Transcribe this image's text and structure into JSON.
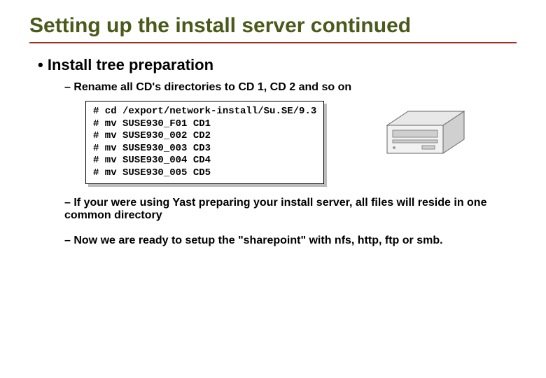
{
  "title": "Setting up the install server continued",
  "bullet1": "Install tree preparation",
  "sub1": "Rename all CD's directories to CD 1, CD 2 and so on",
  "code": "# cd /export/network-install/Su.SE/9.3\n# mv SUSE930_F01 CD1\n# mv SUSE930_002 CD2\n# mv SUSE930_003 CD3\n# mv SUSE930_004 CD4\n# mv SUSE930_005 CD5",
  "sub2": "If your were using Yast preparing your install server, all files will reside in one common directory",
  "sub3": "Now we are ready to setup the \"sharepoint\" with nfs, http, ftp or smb."
}
